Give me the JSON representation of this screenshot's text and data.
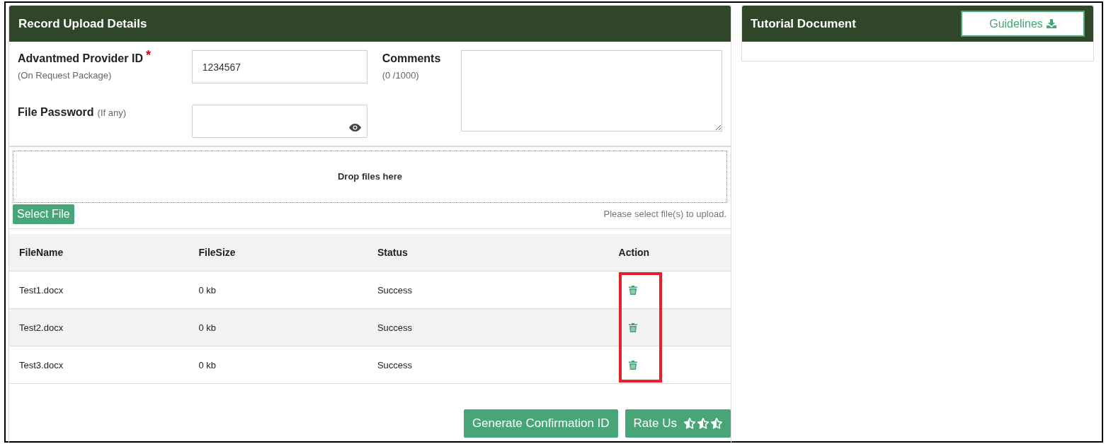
{
  "upload_panel": {
    "title": "Record Upload Details",
    "provider_id": {
      "label": "Advantmed Provider ID",
      "required_mark": "*",
      "hint": "(On Request Package)",
      "value": "1234567"
    },
    "file_password": {
      "label": "File Password",
      "hint": "(If any)"
    },
    "comments": {
      "label": "Comments",
      "counter": "(0 /1000)"
    },
    "dropzone": {
      "text": "Drop files here",
      "button": "Select File",
      "status": "Please select file(s) to upload."
    },
    "table": {
      "columns": [
        "FileName",
        "FileSize",
        "Status",
        "Action"
      ],
      "rows": [
        {
          "file_name": "Test1.docx",
          "file_size": "0 kb",
          "status": "Success"
        },
        {
          "file_name": "Test2.docx",
          "file_size": "0 kb",
          "status": "Success"
        },
        {
          "file_name": "Test3.docx",
          "file_size": "0 kb",
          "status": "Success"
        }
      ]
    },
    "buttons": [
      {
        "kind": "primary",
        "label": "Generate Confirmation ID"
      },
      {
        "kind": "rating",
        "label": "Rate Us"
      }
    ]
  },
  "tutorial_panel": {
    "title": "Tutorial Document",
    "button": "Guidelines"
  }
}
